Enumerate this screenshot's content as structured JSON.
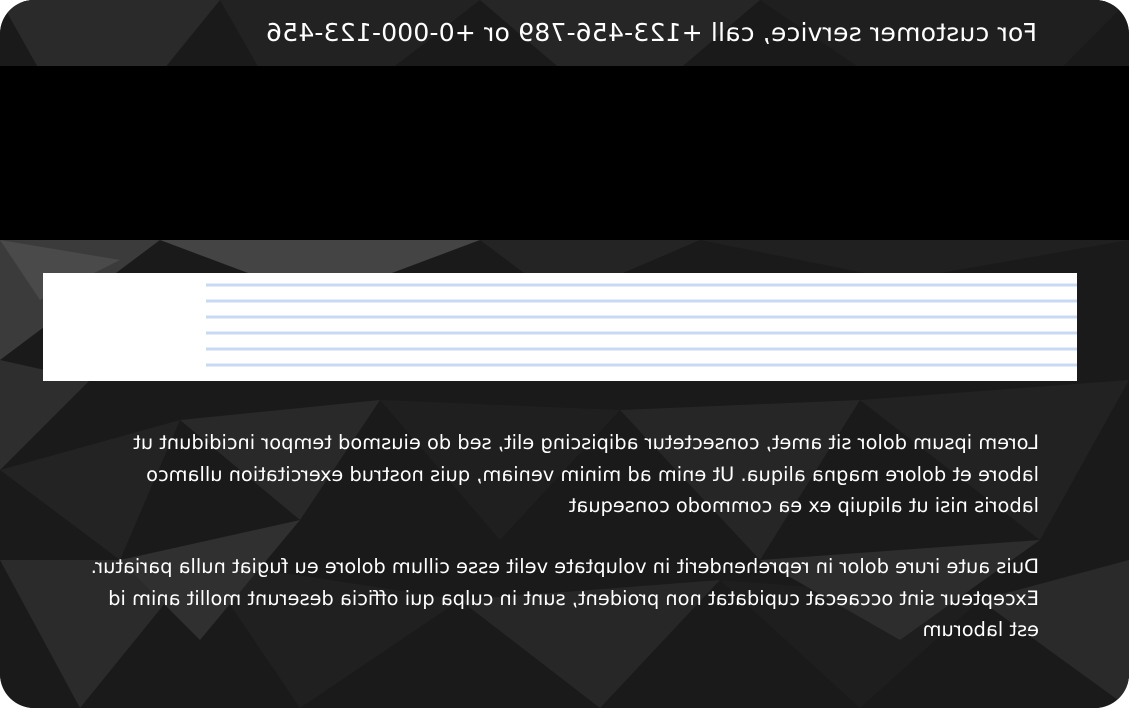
{
  "card": {
    "side": "back",
    "orientation": "mirrored",
    "service_text": "For customer service, call  +123-456-789 or +0-000-123-456",
    "paragraphs": [
      "Lorem ipsum dolor sit amet, consectetur adipiscing elit, sed do eiusmod tempor incididunt ut labore et dolore magna aliqua. Ut enim ad minim veniam, quis nostrud exercitation ullamco laboris nisi ut aliquip ex ea commodo consequat",
      "Duis aute irure dolor in reprehenderit in voluptate velit esse cillum dolore eu fugiat nulla pariatur. Excepteur sint occaecat cupidatat non proident, sunt in culpa qui officia deserunt mollit anim id est laborum"
    ]
  },
  "colors": {
    "background": "#1b1b1b",
    "magnetic_stripe": "#000000",
    "signature_panel": "#ffffff",
    "signature_lines": "#c9d9f5",
    "text": "#ffffff"
  }
}
